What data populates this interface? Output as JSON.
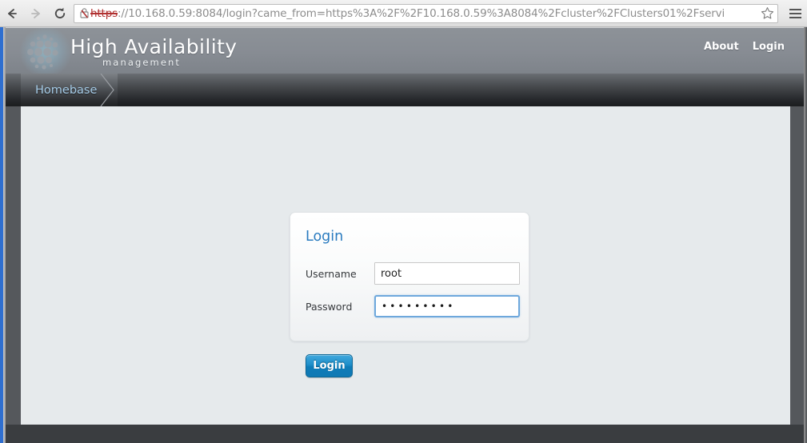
{
  "browser": {
    "back_icon": "back-arrow-icon",
    "forward_icon": "forward-arrow-icon",
    "reload_icon": "reload-icon",
    "cert_icon": "broken-certificate-icon",
    "bookmark_icon": "star-icon",
    "menu_icon": "hamburger-menu-icon",
    "url_scheme": "https",
    "url_rest": "://10.168.0.59:8084/login?came_from=https%3A%2F%2F10.168.0.59%3A8084%2Fcluster%2FClusters01%2Fservi",
    "url_host": "10.168.0.59",
    "url_full": "https://10.168.0.59:8084/login?came_from=https%3A%2F%2F10.168.0.59%3A8084%2Fcluster%2FClusters01%2Fservi"
  },
  "header": {
    "logo_icon": "hexagon-dots-logo-icon",
    "title": "High Availability",
    "subtitle": "management",
    "links": [
      {
        "label": "About",
        "name": "about"
      },
      {
        "label": "Login",
        "name": "login"
      }
    ]
  },
  "nav": {
    "tabs": [
      {
        "label": "Homebase",
        "name": "homebase",
        "active": true
      }
    ]
  },
  "login_form": {
    "title": "Login",
    "username": {
      "label": "Username",
      "value": "root",
      "placeholder": ""
    },
    "password": {
      "label": "Password",
      "value": "•••••••••",
      "masked_char_count": 9,
      "placeholder": "",
      "focused": true
    },
    "submit_label": "Login"
  },
  "colors": {
    "accent_blue": "#2b7cc0",
    "button_blue": "#0f8ac9",
    "tab_text_blue": "#a6cce8",
    "header_gray": "#878c93",
    "content_bg": "#e6eaec",
    "focus_border": "#6ea8dc"
  }
}
